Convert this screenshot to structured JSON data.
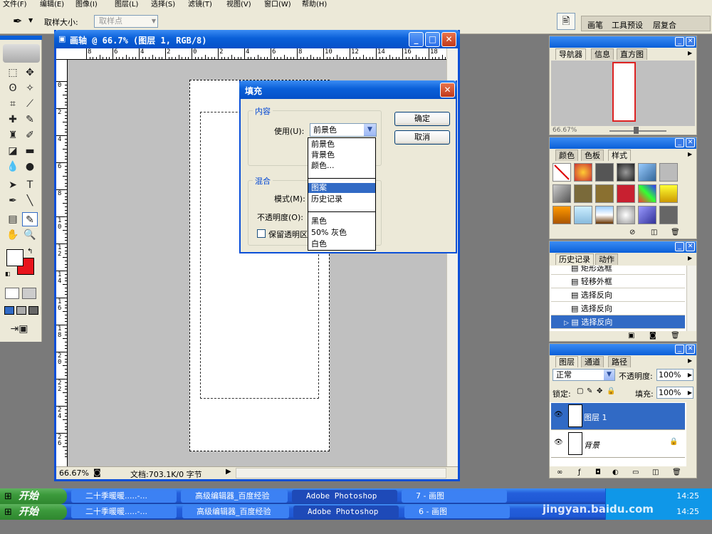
{
  "menu": [
    "文件(F)",
    "编辑(E)",
    "图像(I)",
    "图层(L)",
    "选择(S)",
    "滤镜(T)",
    "视图(V)",
    "窗口(W)",
    "帮助(H)"
  ],
  "options": {
    "sample_size_label": "取样大小:",
    "sample_size_value": "取样点",
    "palette_well": [
      "画笔",
      "工具预设",
      "层复合"
    ]
  },
  "document": {
    "title": "画轴 @ 66.7% (图层 1, RGB/8)",
    "zoom": "66.67%",
    "doc_info": "文档:703.1K/0 字节",
    "ruler_h": [
      "8",
      "6",
      "4",
      "2",
      "0",
      "2",
      "4",
      "6",
      "8",
      "10",
      "12",
      "14",
      "16",
      "18"
    ],
    "ruler_v": [
      "0",
      "2",
      "4",
      "6",
      "8",
      "1 0",
      "1 2",
      "1 4",
      "1 6",
      "1 8",
      "2 0",
      "2 2",
      "2 4",
      "2 6"
    ]
  },
  "fill_dialog": {
    "title": "填充",
    "content_group": "内容",
    "use_label": "使用(U):",
    "use_value": "前景色",
    "blend_group": "混合",
    "mode_label": "模式(M):",
    "opacity_label": "不透明度(O):",
    "preserve_label": "保留透明区",
    "ok_label": "确定",
    "cancel_label": "取消",
    "options": [
      "前景色",
      "背景色",
      "颜色...",
      "图案",
      "历史记录",
      "黑色",
      "50% 灰色",
      "白色"
    ],
    "selected_option": "图案"
  },
  "navigator": {
    "tabs": [
      "导航器",
      "信息",
      "直方图"
    ],
    "zoom": "66.67%"
  },
  "styles_panel": {
    "tabs": [
      "颜色",
      "色板",
      "样式"
    ]
  },
  "history_panel": {
    "tabs": [
      "历史记录",
      "动作"
    ],
    "items": [
      "矩形选框",
      "轻移外框",
      "选择反向",
      "选择反向",
      "选择反向"
    ]
  },
  "layers_panel": {
    "tabs": [
      "图层",
      "通道",
      "路径"
    ],
    "blend_mode": "正常",
    "opacity_label": "不透明度:",
    "opacity_value": "100%",
    "lock_label": "锁定:",
    "fill_label": "填充:",
    "fill_value": "100%",
    "layers": [
      "图层 1",
      "背景"
    ]
  },
  "taskbar": {
    "start_label": "开始",
    "row1": [
      "二十季暖暖.....-...",
      "高级编辑器_百度经验",
      "Adobe Photoshop",
      "7 - 画图"
    ],
    "row2": [
      "二十季暖暖.....-...",
      "高级编辑器_百度经验",
      "Adobe Photoshop",
      "6 - 画图"
    ],
    "clock1": "14:25",
    "clock2": "14:25"
  },
  "watermark": "jingyan.baidu.com",
  "colors": {
    "foreground": "#ffffff",
    "background": "#e8141c",
    "accent": "#0a5fd8",
    "selection": "#316ac5"
  }
}
